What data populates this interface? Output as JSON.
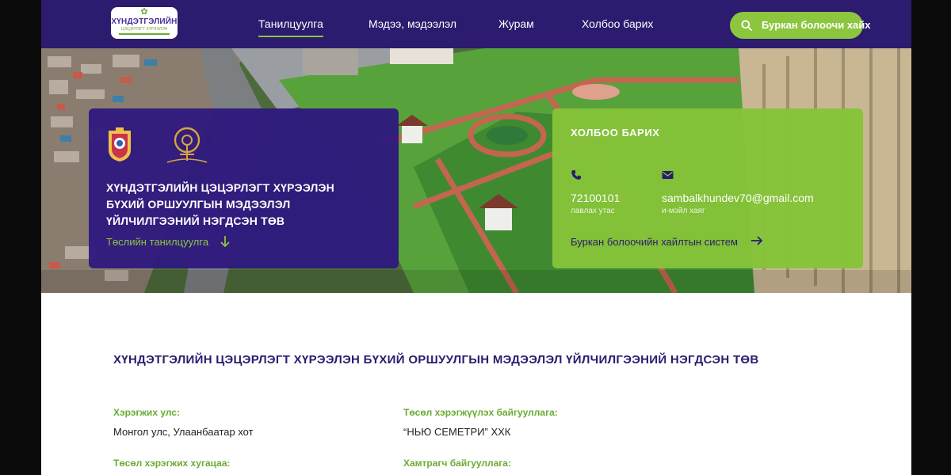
{
  "header": {
    "logo": {
      "name": "ХҮНДЭТГЭЛИЙН",
      "sub": "ЦЭЦЭРЛЭГТ ХҮРЭЭЛЭН"
    },
    "nav": [
      {
        "label": "Танилцуулга",
        "active": true
      },
      {
        "label": "Мэдээ, мэдээлэл",
        "active": false
      },
      {
        "label": "Журам",
        "active": false
      },
      {
        "label": "Холбоо барих",
        "active": false
      }
    ],
    "search_button": {
      "label": "Буркан болоочи хайх",
      "icon": "search-icon"
    }
  },
  "hero": {
    "left_card": {
      "title": "ХҮНДЭТГЭЛИЙН ЦЭЦЭРЛЭГТ ХҮРЭЭЛЭН БҮХИЙ ОРШУУЛГЫН МЭДЭЭЛЭЛ ҮЙЛЧИЛГЭЭНИЙ НЭГДСЭН ТӨВ",
      "link": "Төслийн танилцуулга",
      "icons": [
        "emblem-icon",
        "ring-logo-icon",
        "arrow-down-icon"
      ]
    },
    "right_card": {
      "title": "ХОЛБОО БАРИХ",
      "phone": {
        "value": "72100101",
        "label": "лавлах утас",
        "icon": "phone-icon"
      },
      "email": {
        "value": "sambalkhundev70@gmail.com",
        "label": "и-мэйл хаяг",
        "icon": "mail-icon"
      },
      "link": "Буркан болоочийн хайлтын систем",
      "link_icon": "arrow-right-icon"
    }
  },
  "content": {
    "title": "ХҮНДЭТГЭЛИЙН ЦЭЦЭРЛЭГТ ХҮРЭЭЛЭН БҮХИЙ ОРШУУЛГЫН МЭДЭЭЛЭЛ ҮЙЛЧИЛГЭЭНИЙ НЭГДСЭН ТӨВ",
    "fields": [
      {
        "label": "Хэрэгжих улс:",
        "value": "Монгол улс, Улаанбаатар хот"
      },
      {
        "label": "Төсөл хэрэгжүүлэх байгууллага:",
        "value": "“НЬЮ СЕМЕТРИ” ХХК"
      },
      {
        "label": "Төсөл хэрэгжих хугацаа:",
        "value": ""
      },
      {
        "label": "Хамтрагч байгууллага:",
        "value": ""
      }
    ]
  },
  "colors": {
    "primary": "#2c1b6e",
    "accent": "#8cc63f",
    "accent_text": "#6aab33"
  }
}
